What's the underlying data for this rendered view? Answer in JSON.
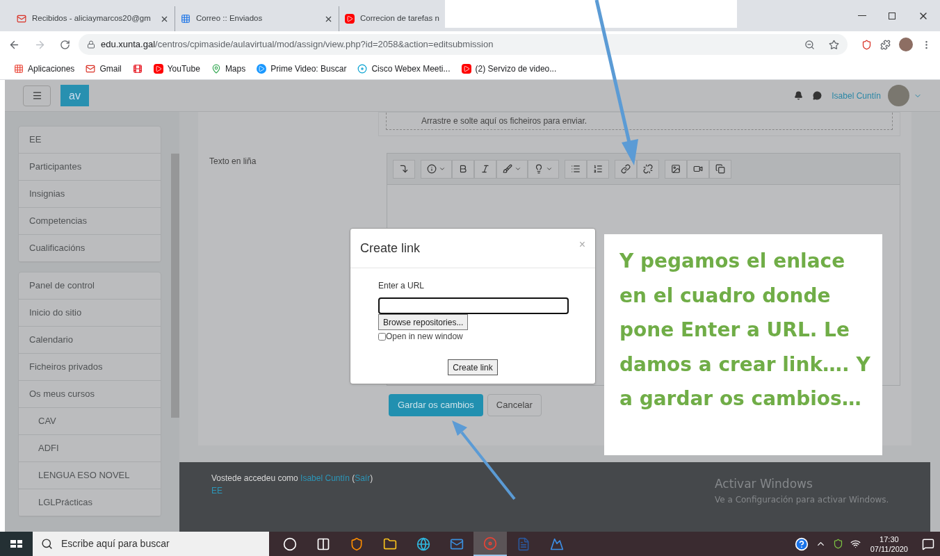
{
  "browser": {
    "tabs": [
      {
        "title": "Recibidos - aliciaymarcos20@gm",
        "kind": "gmail",
        "selected": false
      },
      {
        "title": "Correo :: Enviados",
        "kind": "mail",
        "selected": false
      },
      {
        "title": "Correcion de tarefas n",
        "kind": "youtube",
        "selected": false
      }
    ],
    "address": {
      "host": "edu.xunta.gal",
      "path": "/centros/cpimaside/aulavirtual/mod/assign/view.php?id=2058&action=editsubmission"
    },
    "bookmarks": [
      {
        "label": "Aplicaciones",
        "kind": "apps"
      },
      {
        "label": "Gmail",
        "kind": "gmail"
      },
      {
        "kind": "netflix"
      },
      {
        "label": "YouTube",
        "kind": "youtube"
      },
      {
        "label": "Maps",
        "kind": "maps"
      },
      {
        "label": "Prime Video: Buscar",
        "kind": "prime"
      },
      {
        "label": "Cisco Webex Meeti...",
        "kind": "webex"
      },
      {
        "label": "(2) Servizo de video...",
        "kind": "youtube"
      }
    ]
  },
  "navbar": {
    "logo": "av",
    "user": "Isabel Cuntín"
  },
  "sidebar": {
    "groups": [
      [
        {
          "label": "EE"
        },
        {
          "label": "Participantes"
        },
        {
          "label": "Insignias"
        },
        {
          "label": "Competencias"
        },
        {
          "label": "Cualificacións"
        }
      ],
      [
        {
          "label": "Panel de control"
        },
        {
          "label": "Inicio do sitio"
        },
        {
          "label": "Calendario"
        },
        {
          "label": "Ficheiros privados"
        },
        {
          "label": "Os meus cursos",
          "children": [
            {
              "label": "CAV"
            },
            {
              "label": "ADFI"
            },
            {
              "label": "LENGUA ESO NOVEL"
            },
            {
              "label": "LGLPrácticas"
            }
          ]
        }
      ]
    ]
  },
  "form": {
    "dropzone": "Arrastre e solte aquí os ficheiros para enviar.",
    "field_label": "Texto en liña",
    "toolbar": [
      [
        {
          "kind": "collapse",
          "dropdown": false
        }
      ],
      [
        {
          "kind": "info",
          "dropdown": true
        },
        {
          "kind": "bold",
          "dropdown": false
        },
        {
          "kind": "italic",
          "dropdown": false
        },
        {
          "kind": "brush",
          "dropdown": true
        },
        {
          "kind": "bulb",
          "dropdown": true
        }
      ],
      [
        {
          "kind": "list",
          "dropdown": false
        },
        {
          "kind": "ordered",
          "dropdown": false
        }
      ],
      [
        {
          "kind": "link",
          "dropdown": false
        },
        {
          "kind": "unlink",
          "dropdown": false
        }
      ],
      [
        {
          "kind": "image",
          "dropdown": false
        },
        {
          "kind": "video",
          "dropdown": false
        },
        {
          "kind": "copy",
          "dropdown": false
        }
      ]
    ],
    "save": "Gardar os cambios",
    "cancel": "Cancelar"
  },
  "dialog": {
    "title": "Create link",
    "close": "×",
    "url_label": "Enter a URL",
    "browse": "Browse repositories...",
    "new_window": {
      "label": "Open in new window",
      "checked": false
    },
    "submit": "Create link"
  },
  "annotation": "Y pegamos el enlace en el cuadro donde pone Enter a URL. Le damos a crear link…. Y a gardar os cambios…",
  "footer": {
    "prefix": "Vostede accedeu como",
    "user": "Isabel Cuntín",
    "open_paren": "(",
    "logout": "Saír",
    "close_paren": ")",
    "course": "EE"
  },
  "activation": {
    "title": "Activar Windows",
    "text": "Ve a Configuración para activar Windows."
  },
  "taskbar": {
    "search": "Escribe aquí para buscar",
    "apps": [
      {
        "kind": "cortana",
        "selected": false
      },
      {
        "kind": "taskview",
        "selected": false
      },
      {
        "kind": "brave",
        "selected": false
      },
      {
        "kind": "explorer",
        "selected": false
      },
      {
        "kind": "edge",
        "selected": false
      },
      {
        "kind": "mail",
        "selected": false
      },
      {
        "kind": "chrome",
        "selected": true
      },
      {
        "kind": "word",
        "selected": false
      },
      {
        "kind": "photos",
        "selected": false
      }
    ],
    "time": "17:30",
    "date": "07/11/2020"
  }
}
